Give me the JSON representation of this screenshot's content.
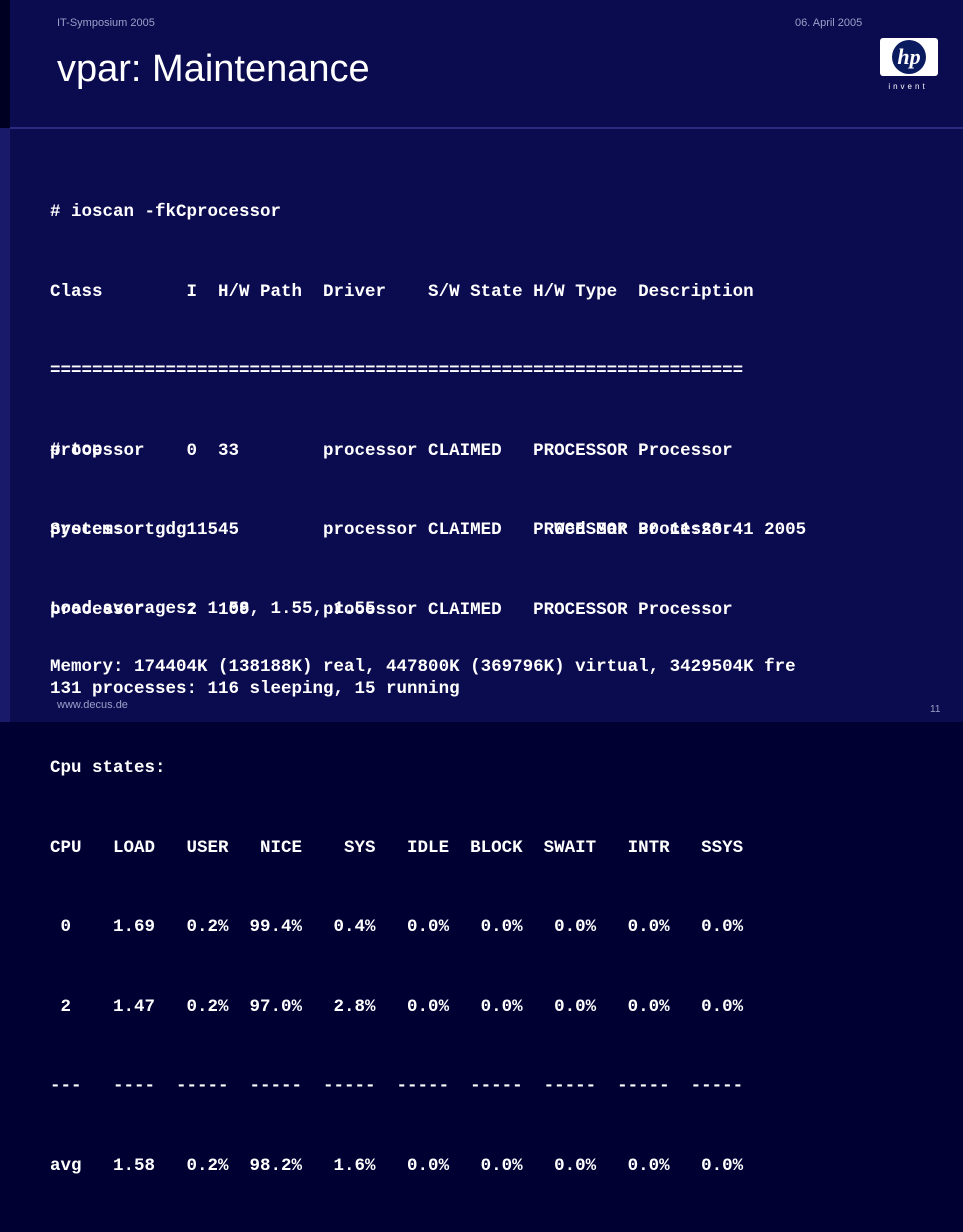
{
  "header": {
    "event": "IT-Symposium 2005",
    "date": "06. April 2005",
    "title": "vpar: Maintenance",
    "logo_mark": "hp",
    "logo_tagline": "invent"
  },
  "ioscan": {
    "lines": [
      "# ioscan -fkCprocessor",
      "Class        I  H/W Path  Driver    S/W State H/W Type  Description",
      "==================================================================",
      "processor    0  33        processor CLAIMED   PROCESSOR Processor",
      "processor    1  45        processor CLAIMED   PROCESSOR Processor",
      "processor    2  109       processor CLAIMED   PROCESSOR Processor"
    ]
  },
  "top": {
    "lines": [
      "# top",
      "System: rtgdg115                                Wed Mar 30 11:23:41 2005",
      "Load averages: 1.58, 1.55, 1.55",
      "131 processes: 116 sleeping, 15 running",
      "Cpu states:",
      "CPU   LOAD   USER   NICE    SYS   IDLE  BLOCK  SWAIT   INTR   SSYS",
      " 0    1.69   0.2%  99.4%   0.4%   0.0%   0.0%   0.0%   0.0%   0.0%",
      " 2    1.47   0.2%  97.0%   2.8%   0.0%   0.0%   0.0%   0.0%   0.0%",
      "---   ----  -----  -----  -----  -----  -----  -----  -----  -----",
      "avg   1.58   0.2%  98.2%   1.6%   0.0%   0.0%   0.0%   0.0%   0.0%"
    ],
    "memory": "Memory: 174404K (138188K) real, 447800K (369796K) virtual, 3429504K fre"
  },
  "footer": {
    "site": "www.decus.de",
    "page": "11"
  }
}
